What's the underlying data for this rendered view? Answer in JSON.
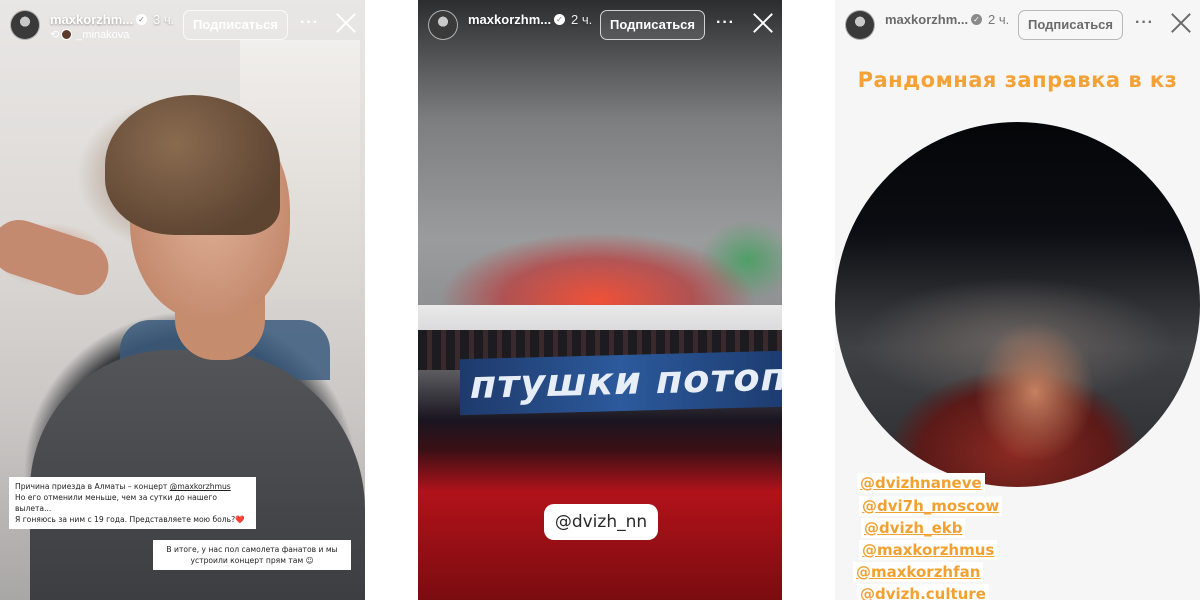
{
  "stories": [
    {
      "username": "maxkorzhm...",
      "time": "3 ч.",
      "repost_from": "_minakova",
      "follow_label": "Подписаться",
      "more_label": "···",
      "caption_1_lines": [
        "Причина приезда в Алматы – концерт ",
        "@maxkorzhmus",
        "Но его отменили меньше, чем за сутки до нашего вылета...",
        "Я гоняюсь за ним с 19 года. Представляете мою боль?❤️"
      ],
      "caption_2_lines": [
        "В итоге, у нас пол самолета фанатов и мы",
        "устроили концерт прям там ☺"
      ]
    },
    {
      "username": "maxkorzhm...",
      "time": "2 ч.",
      "follow_label": "Подписаться",
      "more_label": "···",
      "banner_text": "птушки потопа",
      "handle": "@dvizh_nn"
    },
    {
      "username": "maxkorzhm...",
      "time": "2 ч.",
      "follow_label": "Подписаться",
      "more_label": "···",
      "headline": "Рандомная заправка в кз",
      "mentions": [
        "@dvizhnaneve",
        "@dvi7h_moscow",
        "@dvizh_ekb",
        "@maxkorzhmus",
        "@maxkorzhfan",
        "@dvizh.culture"
      ]
    }
  ]
}
